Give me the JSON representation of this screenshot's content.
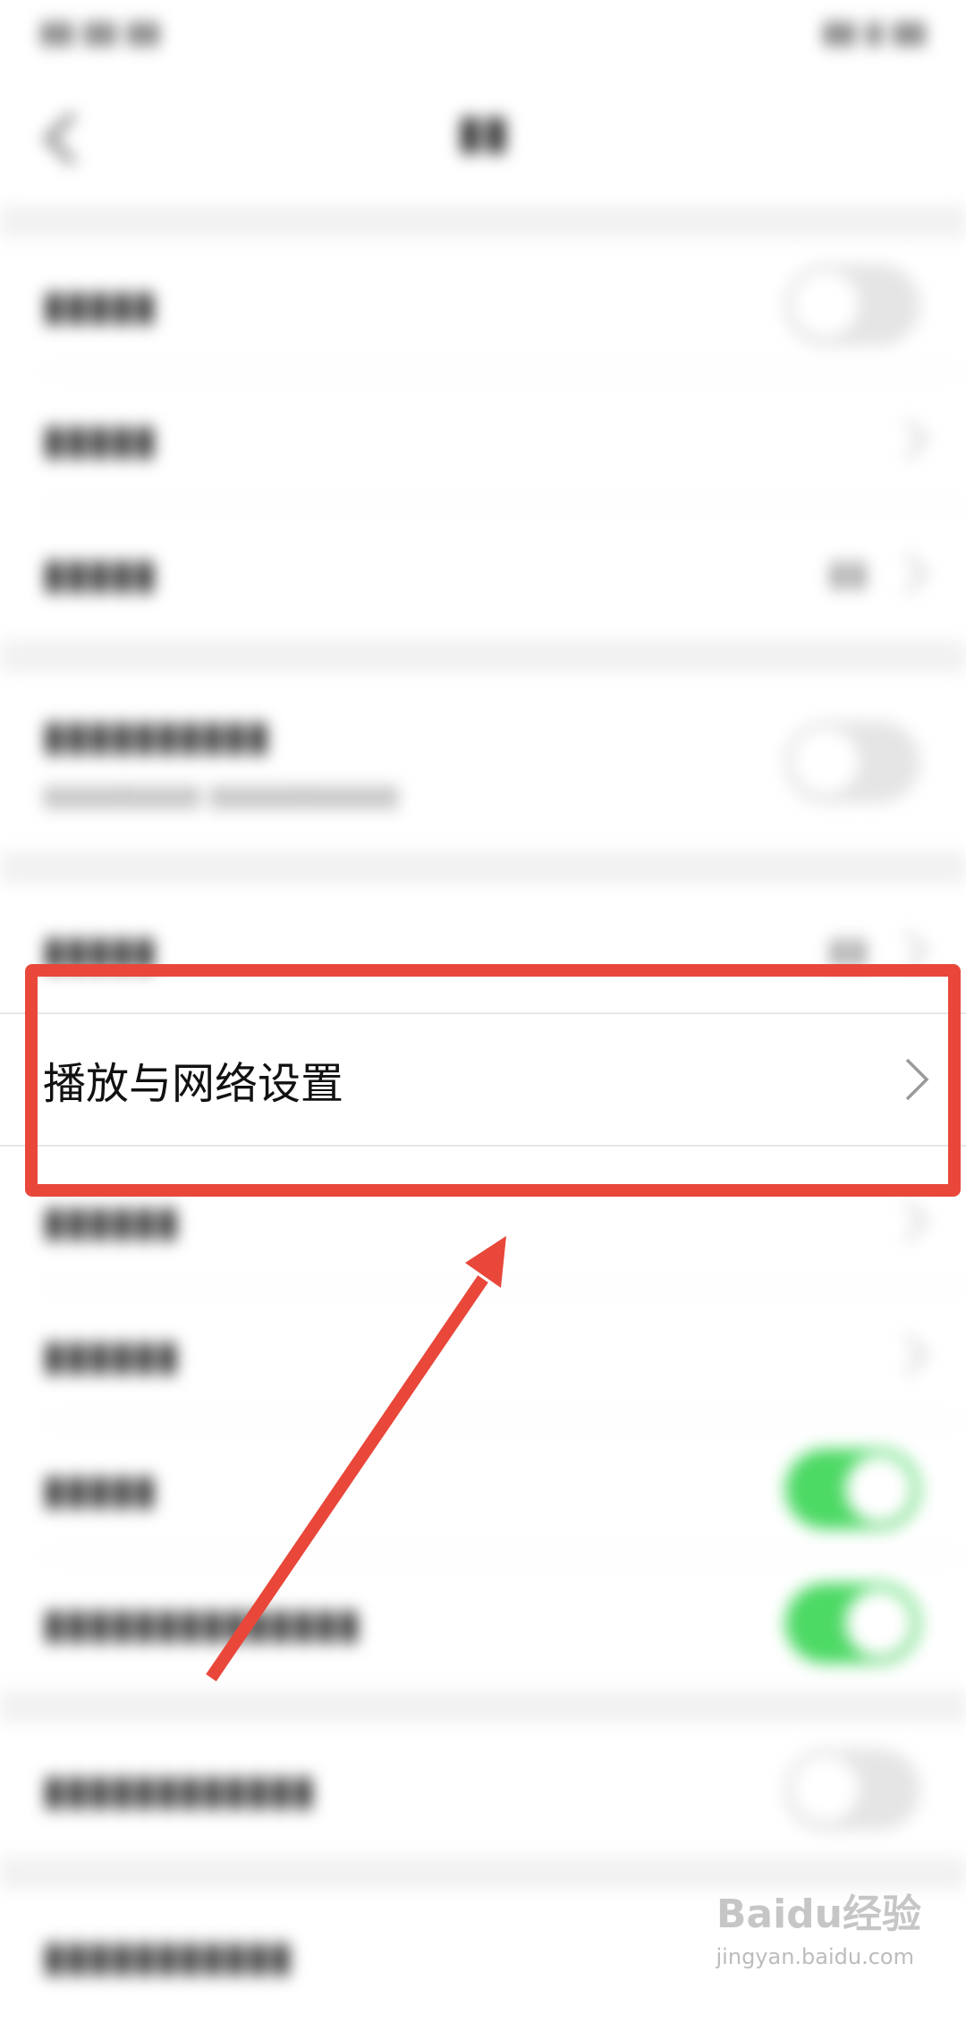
{
  "highlighted_row": {
    "label": "播放与网络设置"
  },
  "blurred_rows": [
    {
      "label": "",
      "has_toggle": true,
      "toggle_on": false
    },
    {
      "label": "",
      "has_chevron": true
    },
    {
      "label": "",
      "has_chevron": true
    },
    {
      "label": "",
      "has_subtitle": true,
      "has_toggle": true,
      "toggle_on": false
    },
    {
      "label": "",
      "has_value": true,
      "has_chevron": true
    },
    {
      "label": "",
      "has_chevron": true
    },
    {
      "label": "",
      "has_chevron": true
    },
    {
      "label": "",
      "has_toggle": true,
      "toggle_on": true
    },
    {
      "label": "",
      "has_toggle": true,
      "toggle_on": true
    },
    {
      "label": "",
      "has_toggle": true,
      "toggle_on": false
    },
    {
      "label": ""
    }
  ],
  "watermark": {
    "brand": "Baidu经验",
    "url": "jingyan.baidu.com"
  },
  "colors": {
    "annotation_red": "#e8473a",
    "toggle_on_green": "#4cd964",
    "section_gap": "#f1f1f1"
  },
  "icons": {
    "back": "chevron-left-icon",
    "row_arrow": "chevron-right-icon"
  }
}
